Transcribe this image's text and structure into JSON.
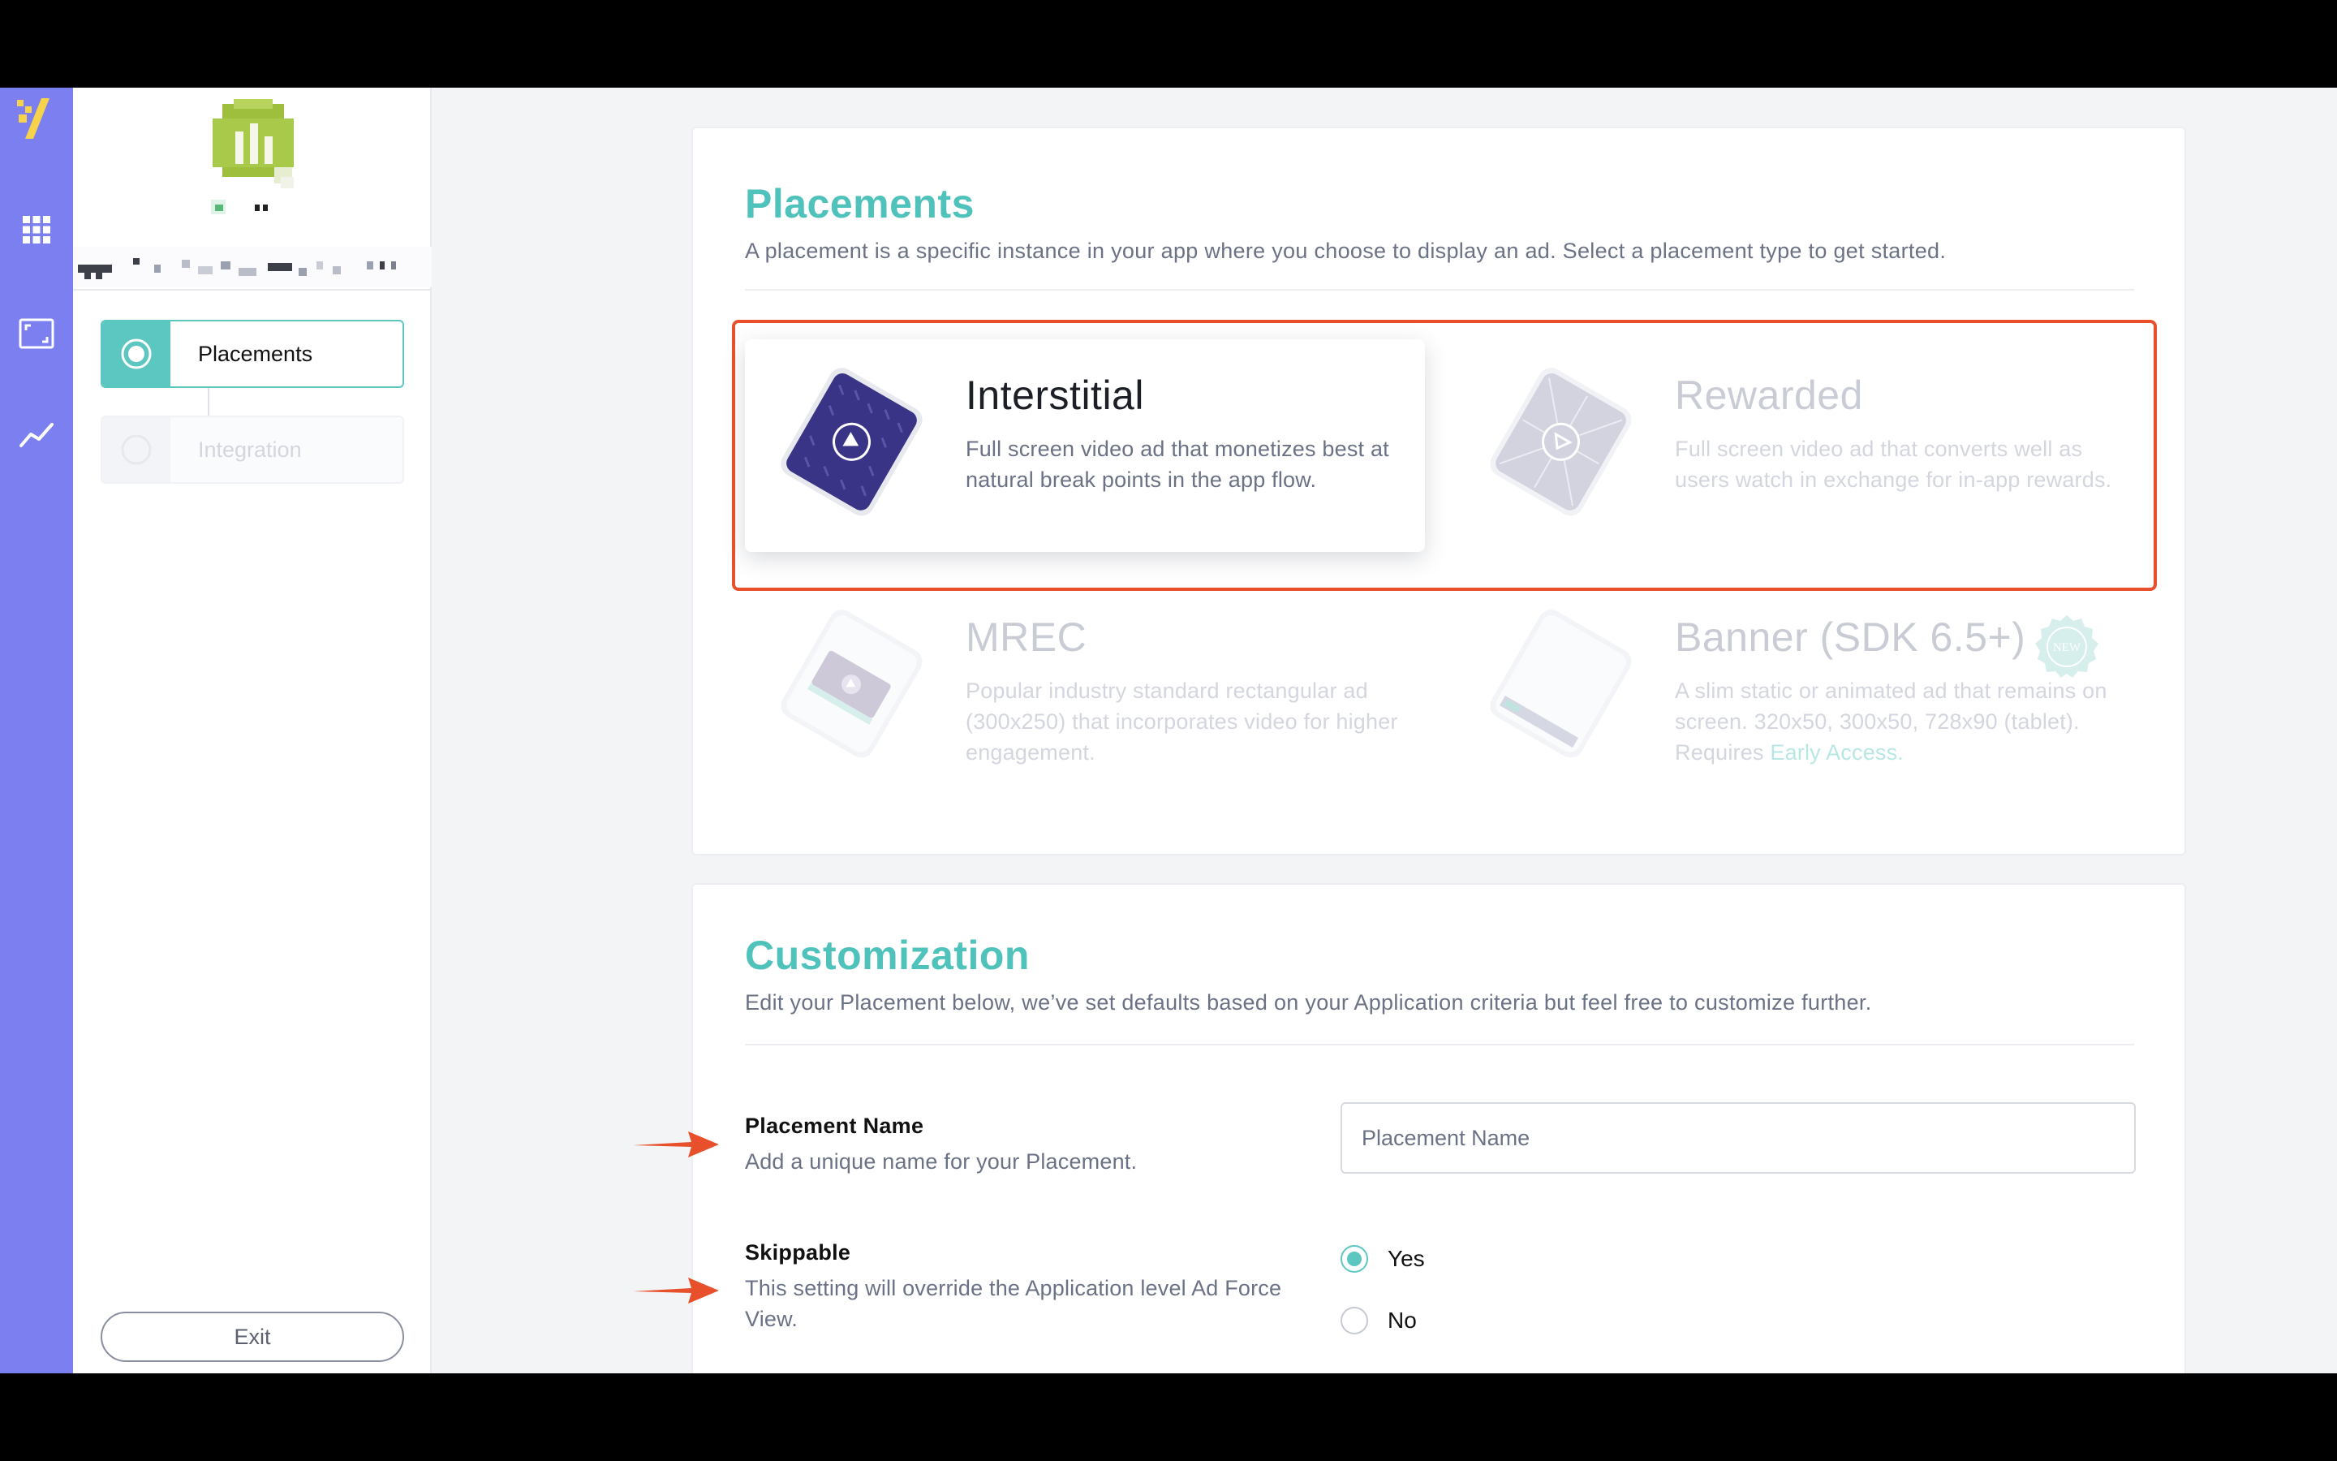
{
  "colors": {
    "rail": "#7b7ff0",
    "accent": "#5cc7c0",
    "title": "#4fc2bb",
    "highlight": "#e8502b",
    "tile_dark_phone": "#3a3487"
  },
  "rail": {
    "icons": [
      "brand-logo-icon",
      "apps-grid-icon",
      "placement-frame-icon",
      "trend-chart-icon"
    ]
  },
  "left_panel": {
    "steps": [
      {
        "label": "Placements",
        "state": "active"
      },
      {
        "label": "Integration",
        "state": "inactive"
      }
    ],
    "exit_label": "Exit"
  },
  "placements": {
    "title": "Placements",
    "subtitle": "A placement is a specific instance in your app where you choose to display an ad. Select a placement type to get started.",
    "types": [
      {
        "name": "Interstitial",
        "description": "Full screen video ad that monetizes best at natural break points in the app flow.",
        "selected": true,
        "icon": "phone-video-icon"
      },
      {
        "name": "Rewarded",
        "description": "Full screen video ad that converts well as users watch in exchange for in-app rewards.",
        "selected": false,
        "icon": "phone-reward-icon"
      },
      {
        "name": "MREC",
        "description": "Popular industry standard rectangular ad (300x250) that incorporates video for higher engagement.",
        "selected": false,
        "icon": "phone-mrec-icon"
      },
      {
        "name": "Banner (SDK 6.5+)",
        "description_prefix": "A slim static or animated ad that remains on screen. 320x50, 300x50, 728x90 (tablet). Requires ",
        "link": "Early Access.",
        "selected": false,
        "icon": "phone-banner-icon",
        "badge": "NEW"
      }
    ]
  },
  "customization": {
    "title": "Customization",
    "subtitle": "Edit your Placement below, we’ve set defaults based on your Application criteria but feel free to customize further.",
    "placement_name": {
      "label": "Placement Name",
      "help": "Add a unique name for your Placement.",
      "placeholder": "Placement Name",
      "value": ""
    },
    "skippable": {
      "label": "Skippable",
      "help": "This setting will override the Application level Ad Force View.",
      "options": [
        "Yes",
        "No"
      ],
      "selected": "Yes"
    }
  }
}
